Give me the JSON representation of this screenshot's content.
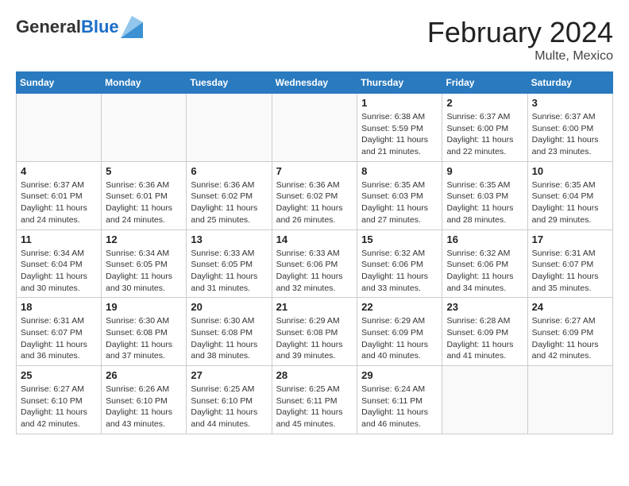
{
  "header": {
    "logo_general": "General",
    "logo_blue": "Blue",
    "month_title": "February 2024",
    "location": "Multe, Mexico"
  },
  "weekdays": [
    "Sunday",
    "Monday",
    "Tuesday",
    "Wednesday",
    "Thursday",
    "Friday",
    "Saturday"
  ],
  "weeks": [
    [
      {
        "day": "",
        "info": ""
      },
      {
        "day": "",
        "info": ""
      },
      {
        "day": "",
        "info": ""
      },
      {
        "day": "",
        "info": ""
      },
      {
        "day": "1",
        "info": "Sunrise: 6:38 AM\nSunset: 5:59 PM\nDaylight: 11 hours\nand 21 minutes."
      },
      {
        "day": "2",
        "info": "Sunrise: 6:37 AM\nSunset: 6:00 PM\nDaylight: 11 hours\nand 22 minutes."
      },
      {
        "day": "3",
        "info": "Sunrise: 6:37 AM\nSunset: 6:00 PM\nDaylight: 11 hours\nand 23 minutes."
      }
    ],
    [
      {
        "day": "4",
        "info": "Sunrise: 6:37 AM\nSunset: 6:01 PM\nDaylight: 11 hours\nand 24 minutes."
      },
      {
        "day": "5",
        "info": "Sunrise: 6:36 AM\nSunset: 6:01 PM\nDaylight: 11 hours\nand 24 minutes."
      },
      {
        "day": "6",
        "info": "Sunrise: 6:36 AM\nSunset: 6:02 PM\nDaylight: 11 hours\nand 25 minutes."
      },
      {
        "day": "7",
        "info": "Sunrise: 6:36 AM\nSunset: 6:02 PM\nDaylight: 11 hours\nand 26 minutes."
      },
      {
        "day": "8",
        "info": "Sunrise: 6:35 AM\nSunset: 6:03 PM\nDaylight: 11 hours\nand 27 minutes."
      },
      {
        "day": "9",
        "info": "Sunrise: 6:35 AM\nSunset: 6:03 PM\nDaylight: 11 hours\nand 28 minutes."
      },
      {
        "day": "10",
        "info": "Sunrise: 6:35 AM\nSunset: 6:04 PM\nDaylight: 11 hours\nand 29 minutes."
      }
    ],
    [
      {
        "day": "11",
        "info": "Sunrise: 6:34 AM\nSunset: 6:04 PM\nDaylight: 11 hours\nand 30 minutes."
      },
      {
        "day": "12",
        "info": "Sunrise: 6:34 AM\nSunset: 6:05 PM\nDaylight: 11 hours\nand 30 minutes."
      },
      {
        "day": "13",
        "info": "Sunrise: 6:33 AM\nSunset: 6:05 PM\nDaylight: 11 hours\nand 31 minutes."
      },
      {
        "day": "14",
        "info": "Sunrise: 6:33 AM\nSunset: 6:06 PM\nDaylight: 11 hours\nand 32 minutes."
      },
      {
        "day": "15",
        "info": "Sunrise: 6:32 AM\nSunset: 6:06 PM\nDaylight: 11 hours\nand 33 minutes."
      },
      {
        "day": "16",
        "info": "Sunrise: 6:32 AM\nSunset: 6:06 PM\nDaylight: 11 hours\nand 34 minutes."
      },
      {
        "day": "17",
        "info": "Sunrise: 6:31 AM\nSunset: 6:07 PM\nDaylight: 11 hours\nand 35 minutes."
      }
    ],
    [
      {
        "day": "18",
        "info": "Sunrise: 6:31 AM\nSunset: 6:07 PM\nDaylight: 11 hours\nand 36 minutes."
      },
      {
        "day": "19",
        "info": "Sunrise: 6:30 AM\nSunset: 6:08 PM\nDaylight: 11 hours\nand 37 minutes."
      },
      {
        "day": "20",
        "info": "Sunrise: 6:30 AM\nSunset: 6:08 PM\nDaylight: 11 hours\nand 38 minutes."
      },
      {
        "day": "21",
        "info": "Sunrise: 6:29 AM\nSunset: 6:08 PM\nDaylight: 11 hours\nand 39 minutes."
      },
      {
        "day": "22",
        "info": "Sunrise: 6:29 AM\nSunset: 6:09 PM\nDaylight: 11 hours\nand 40 minutes."
      },
      {
        "day": "23",
        "info": "Sunrise: 6:28 AM\nSunset: 6:09 PM\nDaylight: 11 hours\nand 41 minutes."
      },
      {
        "day": "24",
        "info": "Sunrise: 6:27 AM\nSunset: 6:09 PM\nDaylight: 11 hours\nand 42 minutes."
      }
    ],
    [
      {
        "day": "25",
        "info": "Sunrise: 6:27 AM\nSunset: 6:10 PM\nDaylight: 11 hours\nand 42 minutes."
      },
      {
        "day": "26",
        "info": "Sunrise: 6:26 AM\nSunset: 6:10 PM\nDaylight: 11 hours\nand 43 minutes."
      },
      {
        "day": "27",
        "info": "Sunrise: 6:25 AM\nSunset: 6:10 PM\nDaylight: 11 hours\nand 44 minutes."
      },
      {
        "day": "28",
        "info": "Sunrise: 6:25 AM\nSunset: 6:11 PM\nDaylight: 11 hours\nand 45 minutes."
      },
      {
        "day": "29",
        "info": "Sunrise: 6:24 AM\nSunset: 6:11 PM\nDaylight: 11 hours\nand 46 minutes."
      },
      {
        "day": "",
        "info": ""
      },
      {
        "day": "",
        "info": ""
      }
    ]
  ]
}
